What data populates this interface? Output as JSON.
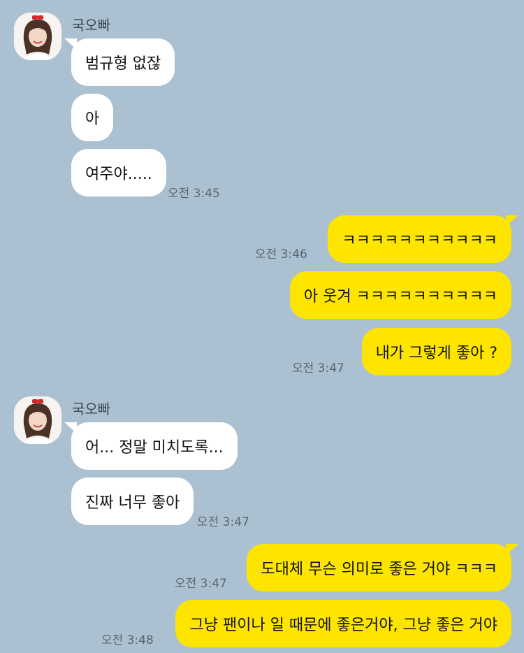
{
  "chat": {
    "sender_name": "국오빠",
    "messages": [
      {
        "text": "범규형 없잖"
      },
      {
        "text": "아"
      },
      {
        "text": "여주야....."
      },
      {
        "text": "ㅋㅋㅋㅋㅋㅋㅋㅋㅋㅋㅋ"
      },
      {
        "text": "아 웃겨 ㅋㅋㅋㅋㅋㅋㅋㅋㅋㅋ"
      },
      {
        "text": "내가 그렇게 좋아 ?"
      },
      {
        "text": "어... 정말 미치도록..."
      },
      {
        "text": "진짜 너무 좋아"
      },
      {
        "text": "도대체 무슨 의미로 좋은 거야 ㅋㅋㅋ"
      },
      {
        "text": "그냥 팬이나 일 때문에 좋은거야, 그냥 좋은 거야"
      }
    ],
    "timestamps": [
      "오전 3:45",
      "오전 3:46",
      "오전 3:47",
      "오전 3:47",
      "오전 3:47",
      "오전 3:48"
    ]
  }
}
